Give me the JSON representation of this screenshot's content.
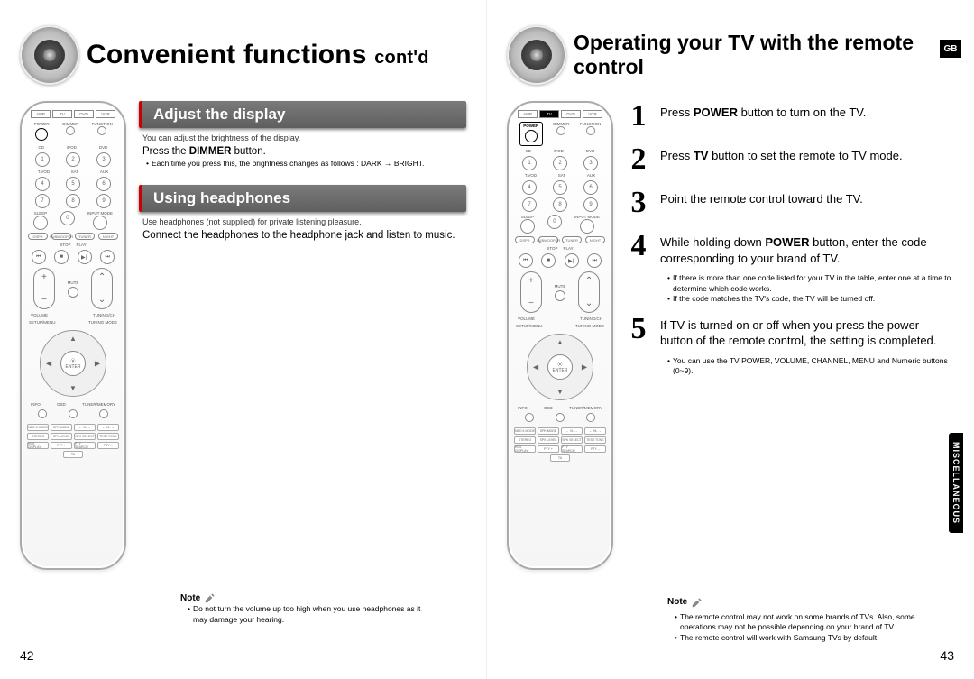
{
  "gb_badge": "GB",
  "left_page": {
    "title_main": "Convenient functions",
    "title_contd": "cont'd",
    "section1": {
      "header": "Adjust the display",
      "intro_small": "You can adjust the brightness of the display.",
      "line1_pre": "Press the ",
      "line1_bold": "DIMMER",
      "line1_post": " button.",
      "bullet": "Each time you press this, the brightness changes as follows : DARK → BRIGHT."
    },
    "section2": {
      "header": "Using headphones",
      "intro_small": "Use headphones (not supplied) for private listening pleasure.",
      "body": "Connect the headphones to the headphone jack and listen to music."
    },
    "note_label": "Note",
    "note_bullet": "Do not turn the volume up too high when you use headphones as it may damage your hearing.",
    "page_number": "42"
  },
  "right_page": {
    "title": "Operating your TV with the remote control",
    "steps": [
      {
        "num": "1",
        "pre": "Press ",
        "b1": "POWER",
        "mid": " button to turn on the TV."
      },
      {
        "num": "2",
        "pre": "Press ",
        "b1": "TV",
        "mid": " button to set the remote to TV mode."
      },
      {
        "num": "3",
        "pre": "Point the remote control toward the TV."
      },
      {
        "num": "4",
        "pre": "While holding down ",
        "b1": "POWER",
        "mid": " button, enter the code corresponding to your brand of TV."
      },
      {
        "num": "5",
        "pre": "If TV is turned on or off when you press the power button of the remote control, the setting is completed."
      }
    ],
    "step4_bullets": [
      "If there is more than one code listed for your TV in the table, enter one at a time to determine which code works.",
      "If the code matches the TV's code, the TV will be turned off."
    ],
    "step5_bullets": [
      "You can use the TV POWER, VOLUME, CHANNEL, MENU and Numeric buttons (0~9)."
    ],
    "note_label": "Note",
    "note_bullets": [
      "The remote control may not work on some brands of TVs. Also, some operations may not be possible depending on your brand of TV.",
      "The remote control will work with Samsung TVs by default."
    ],
    "side_tab": "MISCELLANEOUS",
    "page_number": "43"
  },
  "remote": {
    "modes": [
      "AMP",
      "TV",
      "DVD",
      "VCR"
    ],
    "keys": {
      "power": "POWER",
      "dimmer": "DIMMER",
      "function": "FUNCTION",
      "sleep": "SLEEP",
      "input": "INPUT MODE",
      "mute": "MUTE",
      "volume": "VOLUME",
      "tuning": "TUNING/CH",
      "enter": "ENTER",
      "setup": "SETUP/MENU",
      "tmode": "TUNING MODE",
      "info": "INFO",
      "osd": "OSD",
      "tunermem": "TUNER/MEMORY"
    },
    "num_rows": [
      [
        "1",
        "2",
        "3"
      ],
      [
        "4",
        "5",
        "6"
      ],
      [
        "7",
        "8",
        "9"
      ]
    ],
    "row0b": [
      "CD",
      "iPOD",
      "DVD"
    ],
    "row0c": [
      "T.VOD",
      "SAT",
      "AUX"
    ],
    "trans": [
      "DSPR",
      "SUBWOOFER",
      "TUNER",
      "NIGHT"
    ],
    "stoprow": [
      "STOP",
      "PLAY"
    ],
    "bottom_grid": [
      "NEO 6 MODE",
      "SPK MODE",
      "← VL →",
      "← HL →",
      "STEREO",
      "SPK LEVEL",
      "SPK SELECT",
      "TEST TONE",
      "RDS DISPLAY",
      "PTY +",
      "PTY SEARCH",
      "PTY –",
      "TA"
    ]
  }
}
